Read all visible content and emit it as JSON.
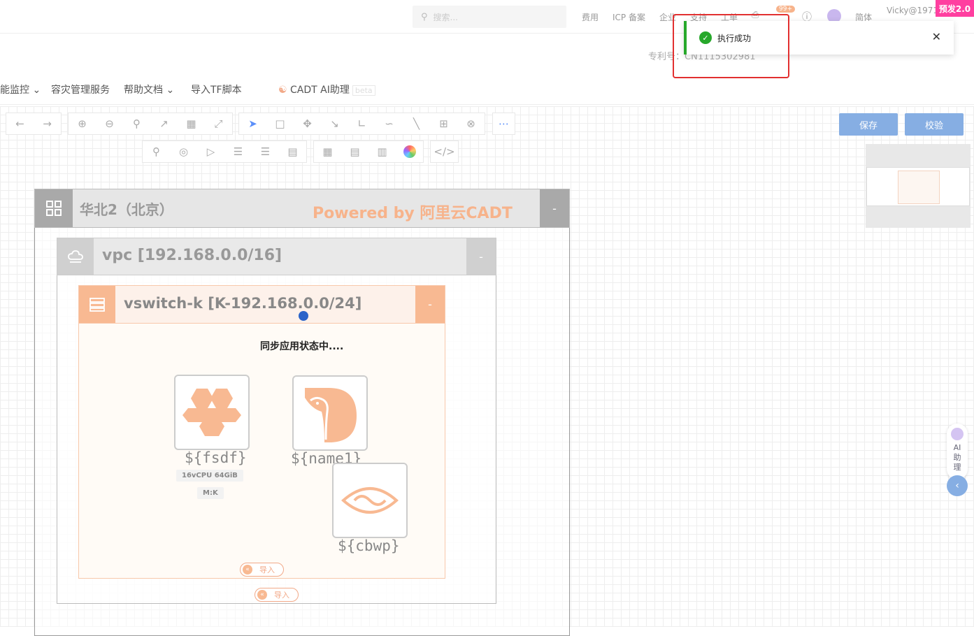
{
  "topbar": {
    "search_placeholder": "搜索...",
    "links": [
      "费用",
      "ICP 备案",
      "企业",
      "支持",
      "工单",
      "简体"
    ],
    "notification_count": "99+",
    "user": "Vicky@1971",
    "prerelease_badge": "预发2.0"
  },
  "patent": {
    "label": "专利号：",
    "value": "CN1115302981"
  },
  "menu": {
    "items": [
      "能监控",
      "容灾管理服务",
      "帮助文档",
      "导入TF脚本"
    ],
    "ai_assistant": "CADT AI助理",
    "beta": "beta"
  },
  "toolbar": {
    "save_label": "保存",
    "verify_label": "校验"
  },
  "diagram": {
    "region_title": "华北2（北京）",
    "powered_by": "Powered by 阿里云CADT",
    "collapse": "-",
    "vpc_title": "vpc [192.168.0.0/16]",
    "vswitch_title": "vswitch-k [K-192.168.0.0/24]",
    "sync_status": "同步应用状态中....",
    "nodes": [
      {
        "label": "${fsdf}",
        "spec": "16vCPU  64GiB",
        "tag": "M:K"
      },
      {
        "label": "${name1}"
      },
      {
        "label": "${cbwp}"
      }
    ],
    "import_label": "导入"
  },
  "toast": {
    "message": "执行成功",
    "color": "#27a82b"
  },
  "ai_float": {
    "label": "AI助理"
  }
}
